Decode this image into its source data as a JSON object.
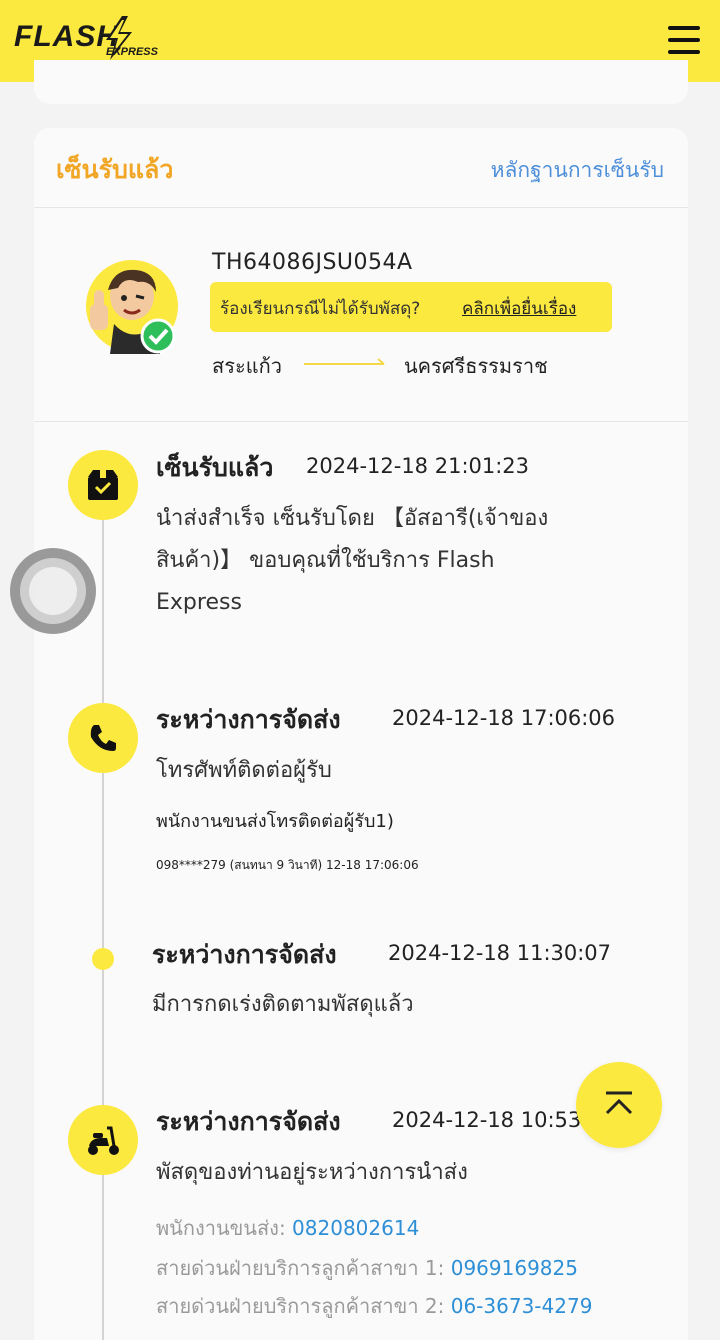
{
  "header": {
    "logo_text": "FLASH",
    "logo_sub": "EXPRESS",
    "menu_icon": "hamburger-menu-icon",
    "bg_color": "#fce93f"
  },
  "status_card": {
    "status_label": "เซ็นรับแล้ว",
    "proof_link": "หลักฐานการเซ็นรับ",
    "tracking_number": "TH64086JSU054A",
    "complaint_question": "ร้องเรียนกรณีไม่ได้รับพัสดุ?",
    "complaint_link": "คลิกเพื่อยื่นเรื่อง",
    "origin": "สระแก้ว",
    "destination": "นครศรีธรรมราช"
  },
  "events": [
    {
      "icon": "package-box-icon",
      "title": "เซ็นรับแล้ว",
      "time": "2024-12-18  21:01:23",
      "desc_line1": "นำส่งสำเร็จ  เซ็นรับโดย 【อัสอารี(เจ้าของ",
      "desc_line2": "สินค้า)】  ขอบคุณที่ใช้บริการ  Flash",
      "desc_line3": "Express"
    },
    {
      "icon": "phone-icon",
      "title": "ระหว่างการจัดส่ง",
      "time": "2024-12-18  17:06:06",
      "desc": "โทรศัพท์ติดต่อผู้รับ",
      "sub": "พนักงานขนส่งโทรติดต่อผู้รับ1)",
      "small": "098****279  (สนทนา  9  วินาที)  12-18  17:06:06"
    },
    {
      "icon": "dot",
      "title": "ระหว่างการจัดส่ง",
      "time": "2024-12-18  11:30:07",
      "desc": "มีการกดเร่งติดตามพัสดุแล้ว"
    },
    {
      "icon": "scooter-icon",
      "title": "ระหว่างการจัดส่ง",
      "time": "2024-12-18  10:53:",
      "desc": "พัสดุของท่านอยู่ระหว่างการนำส่ง",
      "courier_label": "พนักงานขนส่ง:",
      "courier_phone": "0820802614",
      "hotline1_label": "สายด่วนฝ่ายบริการลูกค้าสาขา  1:",
      "hotline1_phone": "0969169825",
      "hotline2_label": "สายด่วนฝ่ายบริการลูกค้าสาขา  2:",
      "hotline2_phone": "06-3673-4279"
    }
  ],
  "colors": {
    "accent_yellow": "#fce93f",
    "status_orange": "#f2a626",
    "link_blue": "#2e8fd6"
  }
}
